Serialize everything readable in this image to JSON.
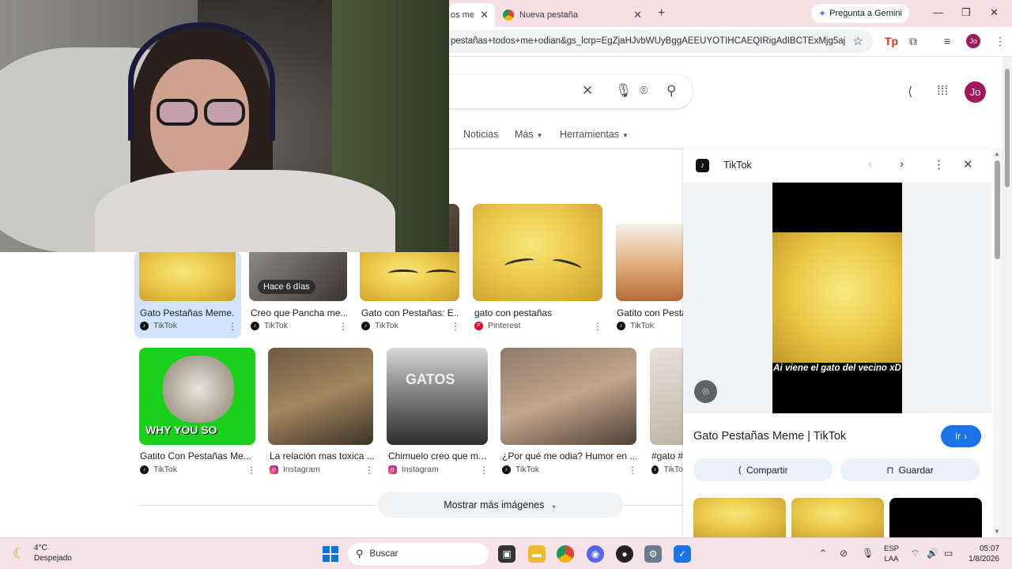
{
  "browser": {
    "tabs": [
      {
        "label": "os me"
      },
      {
        "label": "Nueva pestaña"
      }
    ],
    "gemini_label": "Pregunta a Gemini",
    "url": "pestañas+todos+me+odian&gs_lcrp=EgZjaHJvbWUyBggAEEUYOTIHCAEQIRigAdIBCTExMjg5aj...",
    "profile_initials": "Jo"
  },
  "search": {
    "nav_tabs": [
      {
        "label": "Noticias"
      },
      {
        "label": "Más"
      },
      {
        "label": "Herramientas"
      }
    ],
    "profile_initials": "Jo"
  },
  "results": {
    "row1": [
      {
        "caption": "Gato Pestañas Meme...",
        "source": "TikTok"
      },
      {
        "caption": "Creo que Pancha me...",
        "source": "TikTok",
        "badge": "Hace 6 días"
      },
      {
        "caption": "Gato con Pestañas: E...",
        "source": "TikTok"
      },
      {
        "caption": "gato con pestañas",
        "source": "Pinterest"
      },
      {
        "caption": "Gatito con Pesta",
        "source": "TikTok"
      }
    ],
    "row2": [
      {
        "caption": "Gatito Con Pestañas Me...",
        "source": "TikTok",
        "overlay": "WHY YOU SO"
      },
      {
        "caption": "La relación mas toxica ...",
        "source": "Instagram"
      },
      {
        "caption": "Chimuelo creo que m...",
        "source": "Instagram",
        "overlay": "GATOS"
      },
      {
        "caption": "¿Por qué me odia? Humor en ...",
        "source": "TikTok"
      },
      {
        "caption": "#gato #",
        "source": "TikTo"
      }
    ],
    "show_more_label": "Mostrar más imágenes"
  },
  "preview": {
    "site": "TikTok",
    "video_caption": "Ai viene el gato del vecino xD",
    "title": "Gato Pestañas Meme | TikTok",
    "go_label": "Ir",
    "share_label": "Compartir",
    "save_label": "Guardar"
  },
  "taskbar": {
    "temperature": "4°C",
    "condition": "Despejado",
    "search_label": "Buscar",
    "lang_line1": "ESP",
    "lang_line2": "LAA",
    "time": "05:07",
    "date": "1/8/2026"
  }
}
